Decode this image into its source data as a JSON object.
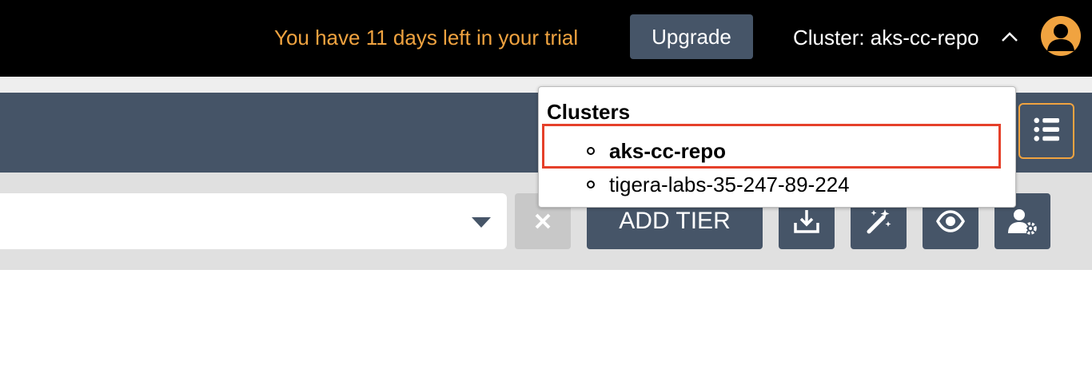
{
  "topbar": {
    "trial_message": "You have 11 days left in your trial",
    "upgrade_label": "Upgrade",
    "cluster_label": "Cluster: aks-cc-repo",
    "chevron_icon": "chevron-up-icon",
    "avatar_icon": "user-avatar-icon",
    "accent_color": "#f0a340"
  },
  "clusters_dropdown": {
    "title": "Clusters",
    "items": [
      {
        "label": "aks-cc-repo",
        "selected": true
      },
      {
        "label": "tigera-labs-35-247-89-224",
        "selected": false
      }
    ],
    "highlight_color": "#e5402a"
  },
  "header": {
    "menu_icon": "list-icon"
  },
  "toolbar": {
    "select_caret_icon": "caret-down-icon",
    "clear_icon": "close-icon",
    "add_tier_label": "ADD TIER",
    "icons": [
      "download-icon",
      "magic-wand-icon",
      "eye-icon",
      "user-settings-icon"
    ],
    "button_color": "#465568"
  }
}
